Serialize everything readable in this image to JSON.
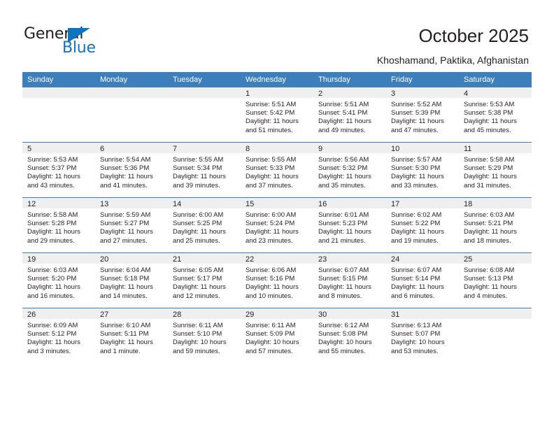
{
  "brand": {
    "name_part1": "General",
    "name_part2": "Blue"
  },
  "header": {
    "title": "October 2025",
    "subtitle": "Khoshamand, Paktika, Afghanistan"
  },
  "colors": {
    "header_blue": "#3d7ebd",
    "brand_blue": "#1073bd",
    "daynum_band": "#efefef",
    "text": "#231f20"
  },
  "labels": {
    "sunrise_prefix": "Sunrise:",
    "sunset_prefix": "Sunset:",
    "daylight_prefix": "Daylight:"
  },
  "weekdays": [
    "Sunday",
    "Monday",
    "Tuesday",
    "Wednesday",
    "Thursday",
    "Friday",
    "Saturday"
  ],
  "weeks": [
    [
      {
        "day": "",
        "empty": true
      },
      {
        "day": "",
        "empty": true
      },
      {
        "day": "",
        "empty": true
      },
      {
        "day": "1",
        "sunrise": "Sunrise: 5:51 AM",
        "sunset": "Sunset: 5:42 PM",
        "daylight_line1": "Daylight: 11 hours",
        "daylight_line2": "and 51 minutes."
      },
      {
        "day": "2",
        "sunrise": "Sunrise: 5:51 AM",
        "sunset": "Sunset: 5:41 PM",
        "daylight_line1": "Daylight: 11 hours",
        "daylight_line2": "and 49 minutes."
      },
      {
        "day": "3",
        "sunrise": "Sunrise: 5:52 AM",
        "sunset": "Sunset: 5:39 PM",
        "daylight_line1": "Daylight: 11 hours",
        "daylight_line2": "and 47 minutes."
      },
      {
        "day": "4",
        "sunrise": "Sunrise: 5:53 AM",
        "sunset": "Sunset: 5:38 PM",
        "daylight_line1": "Daylight: 11 hours",
        "daylight_line2": "and 45 minutes."
      }
    ],
    [
      {
        "day": "5",
        "sunrise": "Sunrise: 5:53 AM",
        "sunset": "Sunset: 5:37 PM",
        "daylight_line1": "Daylight: 11 hours",
        "daylight_line2": "and 43 minutes."
      },
      {
        "day": "6",
        "sunrise": "Sunrise: 5:54 AM",
        "sunset": "Sunset: 5:36 PM",
        "daylight_line1": "Daylight: 11 hours",
        "daylight_line2": "and 41 minutes."
      },
      {
        "day": "7",
        "sunrise": "Sunrise: 5:55 AM",
        "sunset": "Sunset: 5:34 PM",
        "daylight_line1": "Daylight: 11 hours",
        "daylight_line2": "and 39 minutes."
      },
      {
        "day": "8",
        "sunrise": "Sunrise: 5:55 AM",
        "sunset": "Sunset: 5:33 PM",
        "daylight_line1": "Daylight: 11 hours",
        "daylight_line2": "and 37 minutes."
      },
      {
        "day": "9",
        "sunrise": "Sunrise: 5:56 AM",
        "sunset": "Sunset: 5:32 PM",
        "daylight_line1": "Daylight: 11 hours",
        "daylight_line2": "and 35 minutes."
      },
      {
        "day": "10",
        "sunrise": "Sunrise: 5:57 AM",
        "sunset": "Sunset: 5:30 PM",
        "daylight_line1": "Daylight: 11 hours",
        "daylight_line2": "and 33 minutes."
      },
      {
        "day": "11",
        "sunrise": "Sunrise: 5:58 AM",
        "sunset": "Sunset: 5:29 PM",
        "daylight_line1": "Daylight: 11 hours",
        "daylight_line2": "and 31 minutes."
      }
    ],
    [
      {
        "day": "12",
        "sunrise": "Sunrise: 5:58 AM",
        "sunset": "Sunset: 5:28 PM",
        "daylight_line1": "Daylight: 11 hours",
        "daylight_line2": "and 29 minutes."
      },
      {
        "day": "13",
        "sunrise": "Sunrise: 5:59 AM",
        "sunset": "Sunset: 5:27 PM",
        "daylight_line1": "Daylight: 11 hours",
        "daylight_line2": "and 27 minutes."
      },
      {
        "day": "14",
        "sunrise": "Sunrise: 6:00 AM",
        "sunset": "Sunset: 5:25 PM",
        "daylight_line1": "Daylight: 11 hours",
        "daylight_line2": "and 25 minutes."
      },
      {
        "day": "15",
        "sunrise": "Sunrise: 6:00 AM",
        "sunset": "Sunset: 5:24 PM",
        "daylight_line1": "Daylight: 11 hours",
        "daylight_line2": "and 23 minutes."
      },
      {
        "day": "16",
        "sunrise": "Sunrise: 6:01 AM",
        "sunset": "Sunset: 5:23 PM",
        "daylight_line1": "Daylight: 11 hours",
        "daylight_line2": "and 21 minutes."
      },
      {
        "day": "17",
        "sunrise": "Sunrise: 6:02 AM",
        "sunset": "Sunset: 5:22 PM",
        "daylight_line1": "Daylight: 11 hours",
        "daylight_line2": "and 19 minutes."
      },
      {
        "day": "18",
        "sunrise": "Sunrise: 6:03 AM",
        "sunset": "Sunset: 5:21 PM",
        "daylight_line1": "Daylight: 11 hours",
        "daylight_line2": "and 18 minutes."
      }
    ],
    [
      {
        "day": "19",
        "sunrise": "Sunrise: 6:03 AM",
        "sunset": "Sunset: 5:20 PM",
        "daylight_line1": "Daylight: 11 hours",
        "daylight_line2": "and 16 minutes."
      },
      {
        "day": "20",
        "sunrise": "Sunrise: 6:04 AM",
        "sunset": "Sunset: 5:18 PM",
        "daylight_line1": "Daylight: 11 hours",
        "daylight_line2": "and 14 minutes."
      },
      {
        "day": "21",
        "sunrise": "Sunrise: 6:05 AM",
        "sunset": "Sunset: 5:17 PM",
        "daylight_line1": "Daylight: 11 hours",
        "daylight_line2": "and 12 minutes."
      },
      {
        "day": "22",
        "sunrise": "Sunrise: 6:06 AM",
        "sunset": "Sunset: 5:16 PM",
        "daylight_line1": "Daylight: 11 hours",
        "daylight_line2": "and 10 minutes."
      },
      {
        "day": "23",
        "sunrise": "Sunrise: 6:07 AM",
        "sunset": "Sunset: 5:15 PM",
        "daylight_line1": "Daylight: 11 hours",
        "daylight_line2": "and 8 minutes."
      },
      {
        "day": "24",
        "sunrise": "Sunrise: 6:07 AM",
        "sunset": "Sunset: 5:14 PM",
        "daylight_line1": "Daylight: 11 hours",
        "daylight_line2": "and 6 minutes."
      },
      {
        "day": "25",
        "sunrise": "Sunrise: 6:08 AM",
        "sunset": "Sunset: 5:13 PM",
        "daylight_line1": "Daylight: 11 hours",
        "daylight_line2": "and 4 minutes."
      }
    ],
    [
      {
        "day": "26",
        "sunrise": "Sunrise: 6:09 AM",
        "sunset": "Sunset: 5:12 PM",
        "daylight_line1": "Daylight: 11 hours",
        "daylight_line2": "and 3 minutes."
      },
      {
        "day": "27",
        "sunrise": "Sunrise: 6:10 AM",
        "sunset": "Sunset: 5:11 PM",
        "daylight_line1": "Daylight: 11 hours",
        "daylight_line2": "and 1 minute."
      },
      {
        "day": "28",
        "sunrise": "Sunrise: 6:11 AM",
        "sunset": "Sunset: 5:10 PM",
        "daylight_line1": "Daylight: 10 hours",
        "daylight_line2": "and 59 minutes."
      },
      {
        "day": "29",
        "sunrise": "Sunrise: 6:11 AM",
        "sunset": "Sunset: 5:09 PM",
        "daylight_line1": "Daylight: 10 hours",
        "daylight_line2": "and 57 minutes."
      },
      {
        "day": "30",
        "sunrise": "Sunrise: 6:12 AM",
        "sunset": "Sunset: 5:08 PM",
        "daylight_line1": "Daylight: 10 hours",
        "daylight_line2": "and 55 minutes."
      },
      {
        "day": "31",
        "sunrise": "Sunrise: 6:13 AM",
        "sunset": "Sunset: 5:07 PM",
        "daylight_line1": "Daylight: 10 hours",
        "daylight_line2": "and 53 minutes."
      },
      {
        "day": "",
        "empty": true
      }
    ]
  ]
}
